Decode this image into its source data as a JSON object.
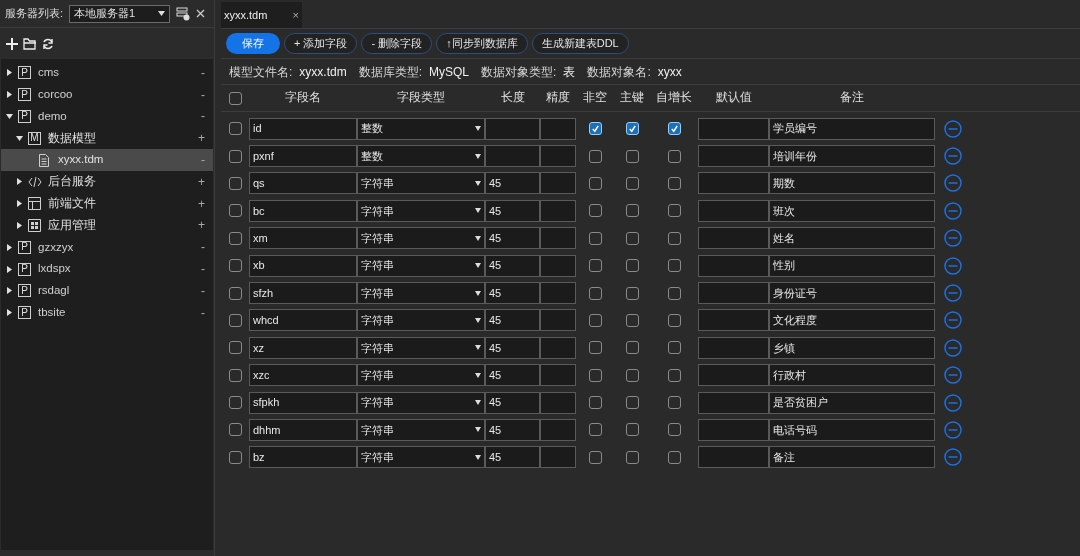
{
  "server_bar": {
    "label": "服务器列表:",
    "server": "本地服务器1"
  },
  "tree": [
    {
      "kind": "project",
      "badge": "P",
      "label": "cms",
      "action": "-",
      "expanded": false,
      "selected": false
    },
    {
      "kind": "project",
      "badge": "P",
      "label": "corcoo",
      "action": "-",
      "expanded": false,
      "selected": false
    },
    {
      "kind": "project",
      "badge": "P",
      "label": "demo",
      "action": "-",
      "expanded": true,
      "selected": false,
      "children": [
        {
          "kind": "model",
          "badge": "M",
          "label": "数据模型",
          "action": "+",
          "expanded": true,
          "selected": false,
          "children": [
            {
              "kind": "file",
              "label": "xyxx.tdm",
              "action": "-",
              "selected": true
            }
          ]
        },
        {
          "kind": "code",
          "label": "后台服务",
          "action": "+",
          "expanded": false,
          "selected": false
        },
        {
          "kind": "layout",
          "label": "前端文件",
          "action": "+",
          "expanded": false,
          "selected": false
        },
        {
          "kind": "grid",
          "label": "应用管理",
          "action": "+",
          "expanded": false,
          "selected": false
        }
      ]
    },
    {
      "kind": "project",
      "badge": "P",
      "label": "gzxzyx",
      "action": "-",
      "expanded": false,
      "selected": false
    },
    {
      "kind": "project",
      "badge": "P",
      "label": "lxdspx",
      "action": "-",
      "expanded": false,
      "selected": false
    },
    {
      "kind": "project",
      "badge": "P",
      "label": "rsdagl",
      "action": "-",
      "expanded": false,
      "selected": false
    },
    {
      "kind": "project",
      "badge": "P",
      "label": "tbsite",
      "action": "-",
      "expanded": false,
      "selected": false
    }
  ],
  "tabs": [
    {
      "label": "xyxx.tdm",
      "close": "×",
      "selected": true
    }
  ],
  "toolbar": [
    {
      "label": "保存",
      "primary": true
    },
    {
      "label": "+ 添加字段",
      "primary": false
    },
    {
      "label": "- 删除字段",
      "primary": false
    },
    {
      "label": "↑同步到数据库",
      "primary": false
    },
    {
      "label": "生成新建表DDL",
      "primary": false
    }
  ],
  "info": [
    {
      "label": "模型文件名:",
      "value": "xyxx.tdm"
    },
    {
      "label": "数据库类型:",
      "value": "MySQL"
    },
    {
      "label": "数据对象类型:",
      "value": "表"
    },
    {
      "label": "数据对象名:",
      "value": "xyxx"
    }
  ],
  "table": {
    "all_checked": false,
    "columns": [
      "字段名",
      "字段类型",
      "长度",
      "精度",
      "非空",
      "主键",
      "自增长",
      "默认值",
      "备注"
    ],
    "rows": [
      {
        "checked": false,
        "name": "id",
        "type": "整数",
        "length": "",
        "not_null": true,
        "primary_key": true,
        "auto_increment": true,
        "note": "学员编号"
      },
      {
        "checked": false,
        "name": "pxnf",
        "type": "整数",
        "length": "",
        "not_null": false,
        "primary_key": false,
        "auto_increment": false,
        "note": "培训年份"
      },
      {
        "checked": false,
        "name": "qs",
        "type": "字符串",
        "length": "45",
        "not_null": false,
        "primary_key": false,
        "auto_increment": false,
        "note": "期数"
      },
      {
        "checked": false,
        "name": "bc",
        "type": "字符串",
        "length": "45",
        "not_null": false,
        "primary_key": false,
        "auto_increment": false,
        "note": "班次"
      },
      {
        "checked": false,
        "name": "xm",
        "type": "字符串",
        "length": "45",
        "not_null": false,
        "primary_key": false,
        "auto_increment": false,
        "note": "姓名"
      },
      {
        "checked": false,
        "name": "xb",
        "type": "字符串",
        "length": "45",
        "not_null": false,
        "primary_key": false,
        "auto_increment": false,
        "note": "性别"
      },
      {
        "checked": false,
        "name": "sfzh",
        "type": "字符串",
        "length": "45",
        "not_null": false,
        "primary_key": false,
        "auto_increment": false,
        "note": "身份证号"
      },
      {
        "checked": false,
        "name": "whcd",
        "type": "字符串",
        "length": "45",
        "not_null": false,
        "primary_key": false,
        "auto_increment": false,
        "note": "文化程度"
      },
      {
        "checked": false,
        "name": "xz",
        "type": "字符串",
        "length": "45",
        "not_null": false,
        "primary_key": false,
        "auto_increment": false,
        "note": "乡镇"
      },
      {
        "checked": false,
        "name": "xzc",
        "type": "字符串",
        "length": "45",
        "not_null": false,
        "primary_key": false,
        "auto_increment": false,
        "note": "行政村"
      },
      {
        "checked": false,
        "name": "sfpkh",
        "type": "字符串",
        "length": "45",
        "not_null": false,
        "primary_key": false,
        "auto_increment": false,
        "note": "是否贫困户"
      },
      {
        "checked": false,
        "name": "dhhm",
        "type": "字符串",
        "length": "45",
        "not_null": false,
        "primary_key": false,
        "auto_increment": false,
        "note": "电话号码"
      },
      {
        "checked": false,
        "name": "bz",
        "type": "字符串",
        "length": "45",
        "not_null": false,
        "primary_key": false,
        "auto_increment": false,
        "note": "备注"
      }
    ]
  }
}
